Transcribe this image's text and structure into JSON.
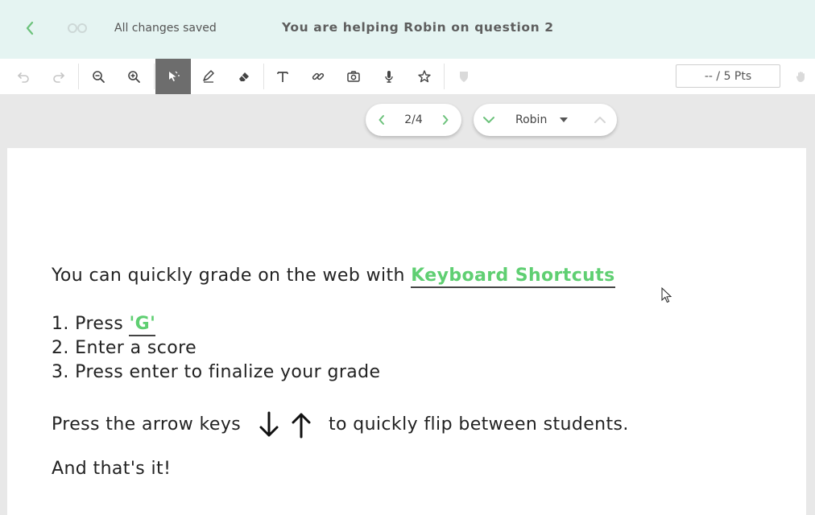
{
  "header": {
    "save_status": "All changes saved",
    "helping_text": "You are helping Robin on question 2"
  },
  "toolbar": {
    "tools": [
      {
        "name": "undo-icon",
        "state": "disabled"
      },
      {
        "name": "redo-icon",
        "state": "disabled"
      },
      {
        "name": "zoom-out-icon",
        "state": "enabled"
      },
      {
        "name": "zoom-in-icon",
        "state": "enabled"
      },
      {
        "name": "select-pointer-icon",
        "state": "active"
      },
      {
        "name": "pen-icon",
        "state": "enabled"
      },
      {
        "name": "eraser-icon",
        "state": "enabled"
      },
      {
        "name": "text-icon",
        "state": "enabled"
      },
      {
        "name": "link-icon",
        "state": "enabled"
      },
      {
        "name": "camera-icon",
        "state": "enabled"
      },
      {
        "name": "microphone-icon",
        "state": "enabled"
      },
      {
        "name": "star-icon",
        "state": "enabled"
      },
      {
        "name": "shield-icon",
        "state": "disabled"
      },
      {
        "name": "hand-icon",
        "state": "disabled"
      }
    ],
    "points_display": "-- / 5 Pts"
  },
  "navigation": {
    "page_indicator": "2/4",
    "student_name": "Robin"
  },
  "document": {
    "line1_text": "You can quickly grade on the web with ",
    "line1_link": "Keyboard Shortcuts",
    "step1_text": "1. Press ",
    "step1_key": "'G'",
    "step2_text": "2. Enter a score",
    "step3_text": "3. Press enter to finalize your grade",
    "arrows_before": "Press the arrow keys",
    "arrows_after": "to quickly flip between students.",
    "closing_text": "And that's it!"
  },
  "colors": {
    "accent_green": "#5fcf72",
    "header_bg": "#e5f4f2",
    "active_tool_bg": "#6d6d6d"
  }
}
